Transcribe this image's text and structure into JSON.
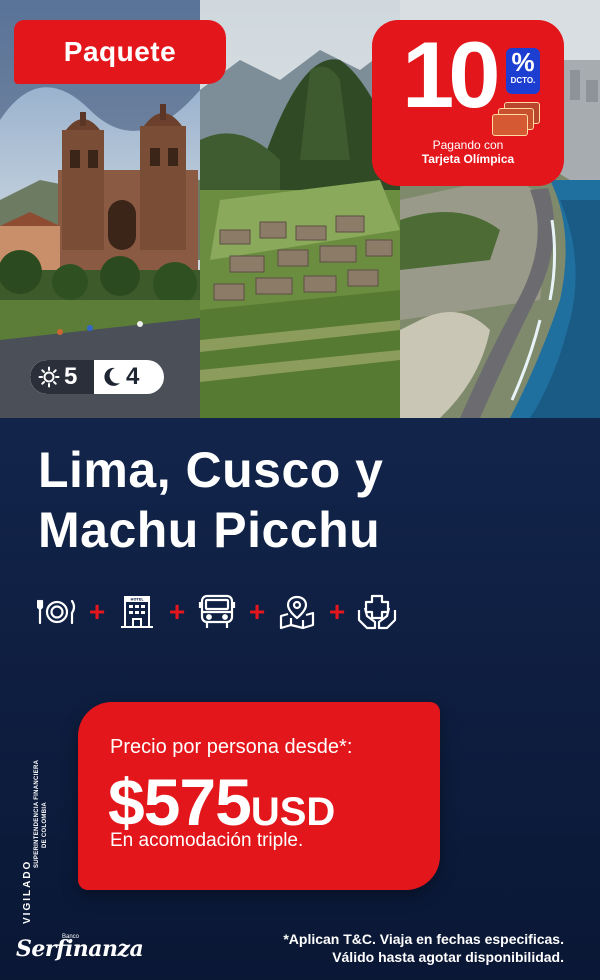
{
  "header": {
    "tag": "Paquete",
    "days": "5",
    "nights": "4"
  },
  "promo": {
    "number": "10",
    "percent": "%",
    "discount": "DCTO.",
    "line1": "Pagando con",
    "line2": "Tarjeta Olímpica"
  },
  "title": {
    "line1": "Lima, Cusco y",
    "line2": "Machu Picchu"
  },
  "includes": {
    "plus": "+",
    "hotel_sign": "HOTEL",
    "icons": [
      "food-icon",
      "hotel-icon",
      "bus-icon",
      "map-location-icon",
      "health-insurance-icon"
    ]
  },
  "price": {
    "label": "Precio por persona desde*:",
    "amount": "$575",
    "currency": "USD",
    "note": "En acomodación triple."
  },
  "regulator": {
    "vigilado": "VIGILADO",
    "line1": "SUPERINTENDENCIA FINANCIERA",
    "line2": "DE COLOMBIA"
  },
  "brand": {
    "sup": "Banco",
    "name": "Serfinanza"
  },
  "disclaimer": {
    "line1": "*Aplican T&C. Viaja en fechas especificas.",
    "line2": "Válido hasta agotar disponibilidad."
  },
  "colors": {
    "accent": "#e3161b",
    "background": "#12244a",
    "percent_badge": "#1d3fd1"
  }
}
